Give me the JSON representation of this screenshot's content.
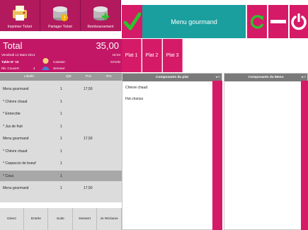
{
  "toolbar": {
    "print_label": "Imprimer Ticket",
    "share_label": "Partager Ticket",
    "refund_label": "Remboursement"
  },
  "header": {
    "menu_title": "Menu gourmand"
  },
  "summary": {
    "total_label": "Total",
    "total_value": "35,00",
    "date": "Vendredi 14 Mars 2014",
    "time": "15:04",
    "table": "Table N° 10",
    "cashier_label": "Caissier:",
    "cashier_name": "DAVID",
    "covers_label": "Nb. Couvert:",
    "covers_value": "4",
    "server_label": "Serveur:"
  },
  "plat_tabs": [
    "Plat 1",
    "Plat 2",
    "Plat 3"
  ],
  "grid": {
    "columns": [
      "Libellé",
      "Qté",
      "Prix",
      "R%"
    ],
    "rows": [
      {
        "label": "Menu gourmand",
        "qty": "1",
        "price": "17,50",
        "selected": false
      },
      {
        "label": "* Chèvre chaud",
        "qty": "1",
        "price": "",
        "selected": false
      },
      {
        "label": "* Entrecôte",
        "qty": "1",
        "price": "",
        "selected": false
      },
      {
        "label": "* Jus de fruit",
        "qty": "1",
        "price": "",
        "selected": false
      },
      {
        "label": "Menu gourmand",
        "qty": "1",
        "price": "17,50",
        "selected": false
      },
      {
        "label": "* Chèvre chaud",
        "qty": "1",
        "price": "",
        "selected": false
      },
      {
        "label": "* Carpaccio de boeuf",
        "qty": "1",
        "price": "",
        "selected": false
      },
      {
        "label": "* Coca",
        "qty": "1",
        "price": "",
        "selected": true
      },
      {
        "label": "Menu gourmand",
        "qty": "1",
        "price": "17,50",
        "selected": false
      }
    ]
  },
  "bottom_buttons": [
    "Direct",
    "Entrée",
    "Suite",
    "Dessert",
    "Je Réclame"
  ],
  "panels": {
    "dish_components": {
      "title": "Composants du plat",
      "items": [
        "Chèvre chaud",
        "Hot chorizo"
      ]
    },
    "menu_components": {
      "title": "Composants du Menu",
      "items": []
    }
  },
  "colors": {
    "accent": "#d51a67",
    "teal": "#1b9e9e",
    "check": "#2fc12f"
  },
  "icons": {
    "print": "printer-icon",
    "share": "share-coins-icon",
    "refund": "refund-coins-icon",
    "validate": "checkmark-icon",
    "refresh": "refresh-icon",
    "minus": "minus-icon",
    "power": "power-icon",
    "user": "user-icon"
  }
}
